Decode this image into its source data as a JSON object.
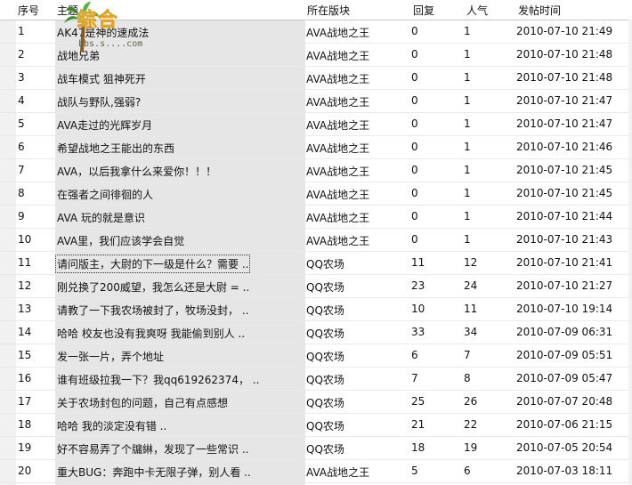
{
  "header": {
    "col_index": "序号",
    "col_title": "主题",
    "col_board": "所在版块",
    "col_reply": "回复",
    "col_popularity": "人气",
    "col_time": "发帖时间"
  },
  "watermark": {
    "text": "综合",
    "url": "bbs.s....com"
  },
  "rows": [
    {
      "idx": "1",
      "title": "AK47是神的速成法",
      "board": "AVA战地之王",
      "reply": "0",
      "pop": "1",
      "time": "2010-07-10 21:49"
    },
    {
      "idx": "2",
      "title": "战地兄弟",
      "board": "AVA战地之王",
      "reply": "0",
      "pop": "1",
      "time": "2010-07-10 21:48"
    },
    {
      "idx": "3",
      "title": "战车模式 狙神死开",
      "board": "AVA战地之王",
      "reply": "0",
      "pop": "1",
      "time": "2010-07-10 21:48"
    },
    {
      "idx": "4",
      "title": "战队与野队,强弱?",
      "board": "AVA战地之王",
      "reply": "0",
      "pop": "1",
      "time": "2010-07-10 21:47"
    },
    {
      "idx": "5",
      "title": "AVA走过的光辉岁月",
      "board": "AVA战地之王",
      "reply": "0",
      "pop": "1",
      "time": "2010-07-10 21:47"
    },
    {
      "idx": "6",
      "title": "希望战地之王能出的东西",
      "board": "AVA战地之王",
      "reply": "0",
      "pop": "1",
      "time": "2010-07-10 21:46"
    },
    {
      "idx": "7",
      "title": "AVA，以后我拿什么来爱你！！！",
      "board": "AVA战地之王",
      "reply": "0",
      "pop": "1",
      "time": "2010-07-10 21:45"
    },
    {
      "idx": "8",
      "title": "在强者之间徘徊的人",
      "board": "AVA战地之王",
      "reply": "0",
      "pop": "1",
      "time": "2010-07-10 21:45"
    },
    {
      "idx": "9",
      "title": "AVA 玩的就是意识",
      "board": "AVA战地之王",
      "reply": "0",
      "pop": "1",
      "time": "2010-07-10 21:44"
    },
    {
      "idx": "10",
      "title": "AVA里，我们应该学会自觉",
      "board": "AVA战地之王",
      "reply": "0",
      "pop": "1",
      "time": "2010-07-10 21:43"
    },
    {
      "idx": "11",
      "title": "请问版主，大尉的下一级是什么？需要 ..",
      "board": "QQ农场",
      "reply": "11",
      "pop": "12",
      "time": "2010-07-10 21:41"
    },
    {
      "idx": "12",
      "title": "刚兑换了200威望，我怎么还是大尉 = ..",
      "board": "QQ农场",
      "reply": "23",
      "pop": "24",
      "time": "2010-07-10 21:27"
    },
    {
      "idx": "13",
      "title": "请教了一下我农场被封了，牧场没封， ..",
      "board": "QQ农场",
      "reply": "10",
      "pop": "11",
      "time": "2010-07-10 19:14"
    },
    {
      "idx": "14",
      "title": "哈哈 校友也没有我爽呀 我能偷到别人 ..",
      "board": "QQ农场",
      "reply": "33",
      "pop": "34",
      "time": "2010-07-09 06:31"
    },
    {
      "idx": "15",
      "title": "发一张一片，弄个地址",
      "board": "QQ农场",
      "reply": "6",
      "pop": "7",
      "time": "2010-07-09 05:51"
    },
    {
      "idx": "16",
      "title": "谁有班级拉我一下？我qq619262374， ..",
      "board": "QQ农场",
      "reply": "7",
      "pop": "8",
      "time": "2010-07-09 05:47"
    },
    {
      "idx": "17",
      "title": "关于农场封包的问题，自己有点感想",
      "board": "QQ农场",
      "reply": "25",
      "pop": "26",
      "time": "2010-07-07 20:48"
    },
    {
      "idx": "18",
      "title": "哈哈 我的淡定没有错   ..",
      "board": "QQ农场",
      "reply": "21",
      "pop": "22",
      "time": "2010-07-06 21:15"
    },
    {
      "idx": "19",
      "title": "好不容易弄了个牖綝，发现了一些常识 ..",
      "board": "QQ农场",
      "reply": "18",
      "pop": "19",
      "time": "2010-07-05 20:54"
    },
    {
      "idx": "20",
      "title": "重大BUG：奔跑中卡无限子弹，别人看 ..",
      "board": "AVA战地之王",
      "reply": "5",
      "pop": "6",
      "time": "2010-07-03 18:11"
    }
  ],
  "colors": {
    "title_column_bg": "#e6e6e6",
    "row_divider": "#e9e9e9",
    "watermark": "#e3a416"
  }
}
